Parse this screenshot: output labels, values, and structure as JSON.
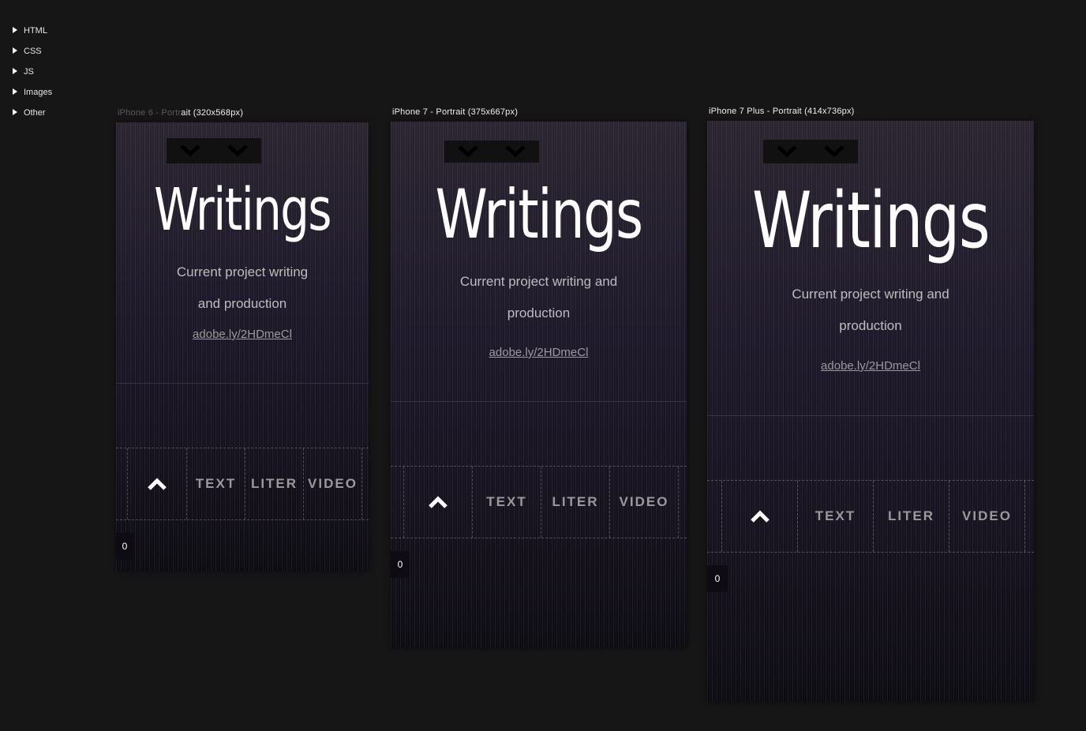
{
  "sidebar": {
    "items": [
      {
        "label": "HTML"
      },
      {
        "label": "CSS"
      },
      {
        "label": "JS"
      },
      {
        "label": "Images"
      },
      {
        "label": "Other"
      }
    ]
  },
  "devices": [
    {
      "label_faded": "iPhone 6 - Portr",
      "label": "ait (320x568px)"
    },
    {
      "label_faded": "",
      "label": "iPhone 7 - Portrait (375x667px)"
    },
    {
      "label_faded": "",
      "label": "iPhone 7 Plus - Portrait (414x736px)"
    }
  ],
  "page": {
    "title": "Writings",
    "subtitle_a": "Current project writing",
    "subtitle_b": "and production",
    "subtitle_wide_a": "Current project writing and",
    "subtitle_wide_b": "production",
    "link": "adobe.ly/2HDmeCl",
    "up_icon": "chevron-up-icon",
    "down_icon": "chevron-down-icon",
    "nav": [
      "TEXT",
      "LITER",
      "VIDEO"
    ],
    "counter": "0"
  }
}
